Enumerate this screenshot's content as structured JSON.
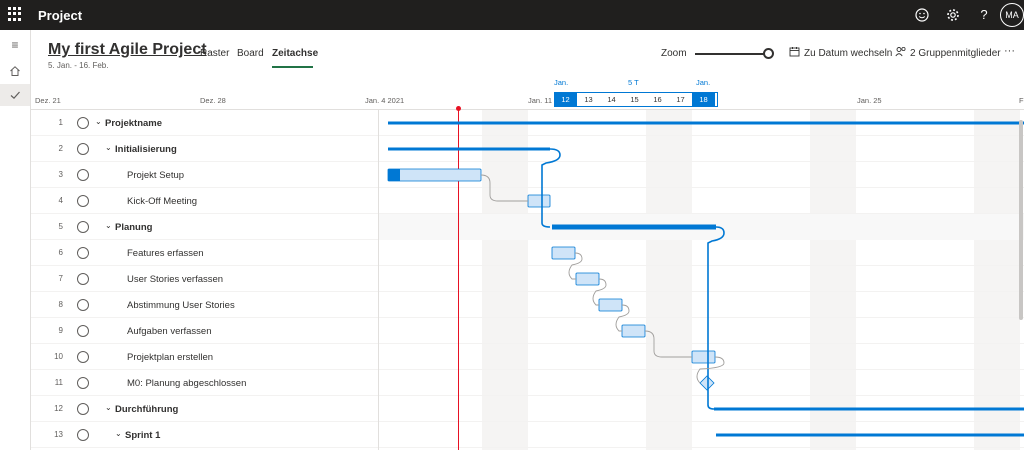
{
  "app": {
    "name": "Project",
    "avatar_initials": "MA"
  },
  "topbar_icons": [
    "smiley-icon",
    "gear-icon",
    "help-icon"
  ],
  "project": {
    "title": "My first Agile Project",
    "dates": "5. Jan. - 16. Feb."
  },
  "views": [
    {
      "label": "Raster",
      "active": false
    },
    {
      "label": "Board",
      "active": false
    },
    {
      "label": "Zeitachse",
      "active": true
    }
  ],
  "toolbar": {
    "zoom_label": "Zoom",
    "goto_date": "Zu Datum wechseln",
    "members": "2 Gruppenmitglieder",
    "more": "···"
  },
  "timeline": {
    "labels": [
      "Dez. 21",
      "Dez. 28",
      "Jan. 4 2021",
      "Jan. 11",
      "Jan. 25",
      "F"
    ],
    "selection": {
      "start_month": "Jan.",
      "end_month": "Jan.",
      "duration": "5 T",
      "days": [
        "12",
        "13",
        "14",
        "15",
        "16",
        "17",
        "18"
      ],
      "highlighted": [
        "12",
        "18"
      ]
    }
  },
  "rows": [
    {
      "num": "1",
      "name": "Projektname",
      "level": 0,
      "bold": true,
      "collapsible": true
    },
    {
      "num": "2",
      "name": "Initialisierung",
      "level": 1,
      "bold": true,
      "collapsible": true
    },
    {
      "num": "3",
      "name": "Projekt Setup",
      "level": 2,
      "bold": false,
      "collapsible": false
    },
    {
      "num": "4",
      "name": "Kick-Off Meeting",
      "level": 2,
      "bold": false,
      "collapsible": false
    },
    {
      "num": "5",
      "name": "Planung",
      "level": 1,
      "bold": true,
      "collapsible": true
    },
    {
      "num": "6",
      "name": "Features erfassen",
      "level": 2,
      "bold": false,
      "collapsible": false
    },
    {
      "num": "7",
      "name": "User Stories verfassen",
      "level": 2,
      "bold": false,
      "collapsible": false
    },
    {
      "num": "8",
      "name": "Abstimmung User Stories",
      "level": 2,
      "bold": false,
      "collapsible": false
    },
    {
      "num": "9",
      "name": "Aufgaben verfassen",
      "level": 2,
      "bold": false,
      "collapsible": false
    },
    {
      "num": "10",
      "name": "Projektplan erstellen",
      "level": 2,
      "bold": false,
      "collapsible": false
    },
    {
      "num": "11",
      "name": "M0: Planung abgeschlossen",
      "level": 2,
      "bold": false,
      "collapsible": false
    },
    {
      "num": "12",
      "name": "Durchführung",
      "level": 1,
      "bold": true,
      "collapsible": true
    },
    {
      "num": "13",
      "name": "Sprint 1",
      "level": 2,
      "bold": true,
      "collapsible": true
    }
  ],
  "colors": {
    "accent": "#0078d4",
    "task_fill": "#cfe4f8",
    "today_line": "#e81123",
    "topbar": "#201f1e",
    "tab_underline": "#217346"
  }
}
